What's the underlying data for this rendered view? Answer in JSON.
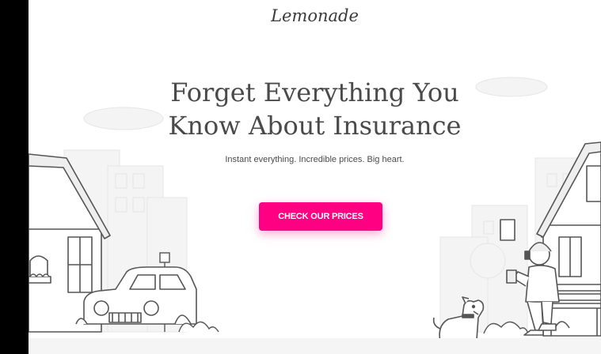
{
  "brand": {
    "name": "Lemonade"
  },
  "hero": {
    "title_line1": "Forget Everything You",
    "title_line2": "Know About Insurance",
    "subtitle": "Instant everything. Incredible prices. Big heart."
  },
  "cta": {
    "label": "CHECK OUR PRICES",
    "color": "#ff0083"
  },
  "colors": {
    "text": "#4a4a4a",
    "line_art": "#555555",
    "background": "#ffffff",
    "frame": "#000000"
  },
  "icons": [
    "house-illustration",
    "car-illustration",
    "dog-illustration",
    "person-with-headphones-illustration",
    "bench-illustration",
    "city-buildings-illustration"
  ]
}
